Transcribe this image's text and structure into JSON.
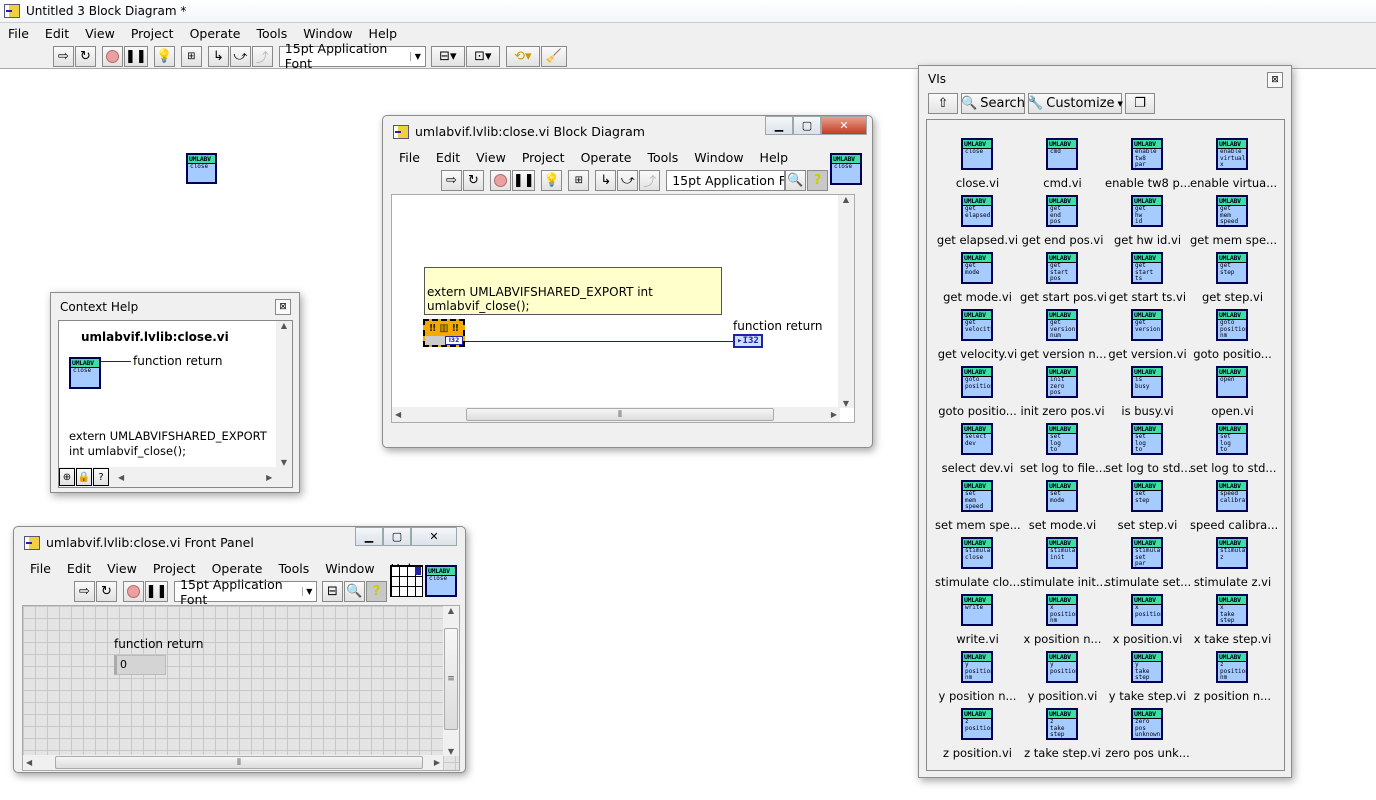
{
  "main": {
    "title": "Untitled 3 Block Diagram *",
    "menu": [
      "File",
      "Edit",
      "View",
      "Project",
      "Operate",
      "Tools",
      "Window",
      "Help"
    ],
    "font": "15pt Application Font",
    "canvas_vi": {
      "header": "UMLABV",
      "sub": "close"
    }
  },
  "block_diagram": {
    "title": "umlabvif.lvlib:close.vi Block Diagram",
    "menu": [
      "File",
      "Edit",
      "View",
      "Project",
      "Operate",
      "Tools",
      "Window",
      "Help"
    ],
    "font": "15pt Application Font",
    "icon": {
      "header": "UMLABV",
      "sub": "close"
    },
    "comment": "extern UMLABVIFSHARED_EXPORT int umlabvif_close();",
    "indicator_label": "function return",
    "indicator_type": "I32",
    "node_type": "I32"
  },
  "context_help": {
    "title": "Context Help",
    "vi_name": "umlabvif.lvlib:close.vi",
    "terminal": "function return",
    "icon": {
      "header": "UMLABV",
      "sub": "close"
    },
    "description_1": "extern UMLABVIFSHARED_EXPORT",
    "description_2": "int umlabvif_close();"
  },
  "front_panel": {
    "title": "umlabvif.lvlib:close.vi Front Panel",
    "menu": [
      "File",
      "Edit",
      "View",
      "Project",
      "Operate",
      "Tools",
      "Window",
      "Help"
    ],
    "font": "15pt Application Font",
    "icon": {
      "header": "UMLABV",
      "sub": "close"
    },
    "indicator_label": "function return",
    "indicator_value": "0"
  },
  "palette": {
    "title": "VIs",
    "search": "Search",
    "customize": "Customize",
    "items": [
      {
        "label": "close.vi",
        "sub": "close"
      },
      {
        "label": "cmd.vi",
        "sub": "cmd"
      },
      {
        "label": "enable tw8 p...",
        "sub": "enable\ntw8\npar"
      },
      {
        "label": "enable virtua...",
        "sub": "enable\nvirtual\nx"
      },
      {
        "label": "get elapsed.vi",
        "sub": "get\nelapsed"
      },
      {
        "label": "get end pos.vi",
        "sub": "get\nend\npos"
      },
      {
        "label": "get hw id.vi",
        "sub": "get\nhw\nid"
      },
      {
        "label": "get mem spe...",
        "sub": "get\nmem\nspeed"
      },
      {
        "label": "get mode.vi",
        "sub": "get\nmode"
      },
      {
        "label": "get start pos.vi",
        "sub": "get\nstart\npos"
      },
      {
        "label": "get start ts.vi",
        "sub": "get\nstart\nts"
      },
      {
        "label": "get step.vi",
        "sub": "get\nstep"
      },
      {
        "label": "get velocity.vi",
        "sub": "get\nvelocity"
      },
      {
        "label": "get version n...",
        "sub": "get\nversion\nnum"
      },
      {
        "label": "get version.vi",
        "sub": "get\nversion"
      },
      {
        "label": "goto positio...",
        "sub": "goto\nposition\nnm"
      },
      {
        "label": "goto positio...",
        "sub": "goto\nposition"
      },
      {
        "label": "init zero pos.vi",
        "sub": "init\nzero\npos"
      },
      {
        "label": "is busy.vi",
        "sub": "is\nbusy"
      },
      {
        "label": "open.vi",
        "sub": "open"
      },
      {
        "label": "select dev.vi",
        "sub": "select\ndev"
      },
      {
        "label": "set log to file...",
        "sub": "set\nlog\nto"
      },
      {
        "label": "set log to std...",
        "sub": "set\nlog\nto"
      },
      {
        "label": "set log to std...",
        "sub": "set\nlog\nto"
      },
      {
        "label": "set mem spe...",
        "sub": "set\nmem\nspeed"
      },
      {
        "label": "set mode.vi",
        "sub": "set\nmode"
      },
      {
        "label": "set step.vi",
        "sub": "set\nstep"
      },
      {
        "label": "speed calibra...",
        "sub": "speed\ncalibrati"
      },
      {
        "label": "stimulate clo...",
        "sub": "stimulat\nclose"
      },
      {
        "label": "stimulate init...",
        "sub": "stimulat\ninit"
      },
      {
        "label": "stimulate set...",
        "sub": "stimulat\nset\npar"
      },
      {
        "label": "stimulate z.vi",
        "sub": "stimulat\nz"
      },
      {
        "label": "write.vi",
        "sub": "write"
      },
      {
        "label": "x position n...",
        "sub": "x\nposition\nnm"
      },
      {
        "label": "x position.vi",
        "sub": "x\nposition"
      },
      {
        "label": "x take step.vi",
        "sub": "x\ntake\nstep"
      },
      {
        "label": "y position n...",
        "sub": "y\nposition\nnm"
      },
      {
        "label": "y position.vi",
        "sub": "y\nposition"
      },
      {
        "label": "y take step.vi",
        "sub": "y\ntake\nstep"
      },
      {
        "label": "z position n...",
        "sub": "z\nposition\nnm"
      },
      {
        "label": "z position.vi",
        "sub": "z\nposition"
      },
      {
        "label": "z take step.vi",
        "sub": "z\ntake\nstep"
      },
      {
        "label": "zero pos unk...",
        "sub": "zero\npos\nunknown"
      }
    ]
  },
  "colors": {
    "vi_body": "#a6ccff",
    "vi_header": "#3ce0a0",
    "node": "#f5a800",
    "comment": "#ffffcc",
    "wire": "#1a1aa0"
  }
}
